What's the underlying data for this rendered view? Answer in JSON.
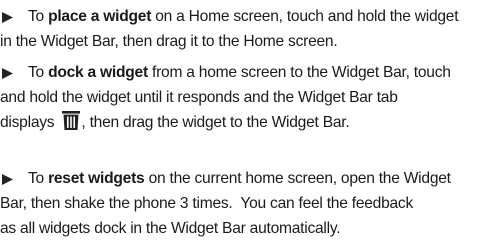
{
  "instructions": [
    {
      "intro": "To ",
      "bold": "place a widget",
      "line1_rest": " on a Home screen, touch and hold the widget",
      "line2": "in the Widget Bar, then drag it to the Home screen."
    },
    {
      "intro": "To ",
      "bold": "dock a widget",
      "line1_rest": " from a home screen to the Widget Bar, touch",
      "line2": "and hold the widget until it responds and the Widget Bar tab",
      "line3_before_icon": "displays ",
      "line3_icon": "trash-can-icon",
      "line3_after_icon": ", then drag the widget to the Widget Bar."
    },
    {
      "intro": "To ",
      "bold": "reset widgets",
      "line1_rest": " on the current home screen, open the Widget",
      "line2": "Bar, then shake the phone 3 times.  You can feel the feedback",
      "line3": "as all widgets dock in the Widget Bar automatically."
    }
  ],
  "colors": {
    "text": "#1a1a1a",
    "bullet": "#222222",
    "icon": "#222222"
  }
}
